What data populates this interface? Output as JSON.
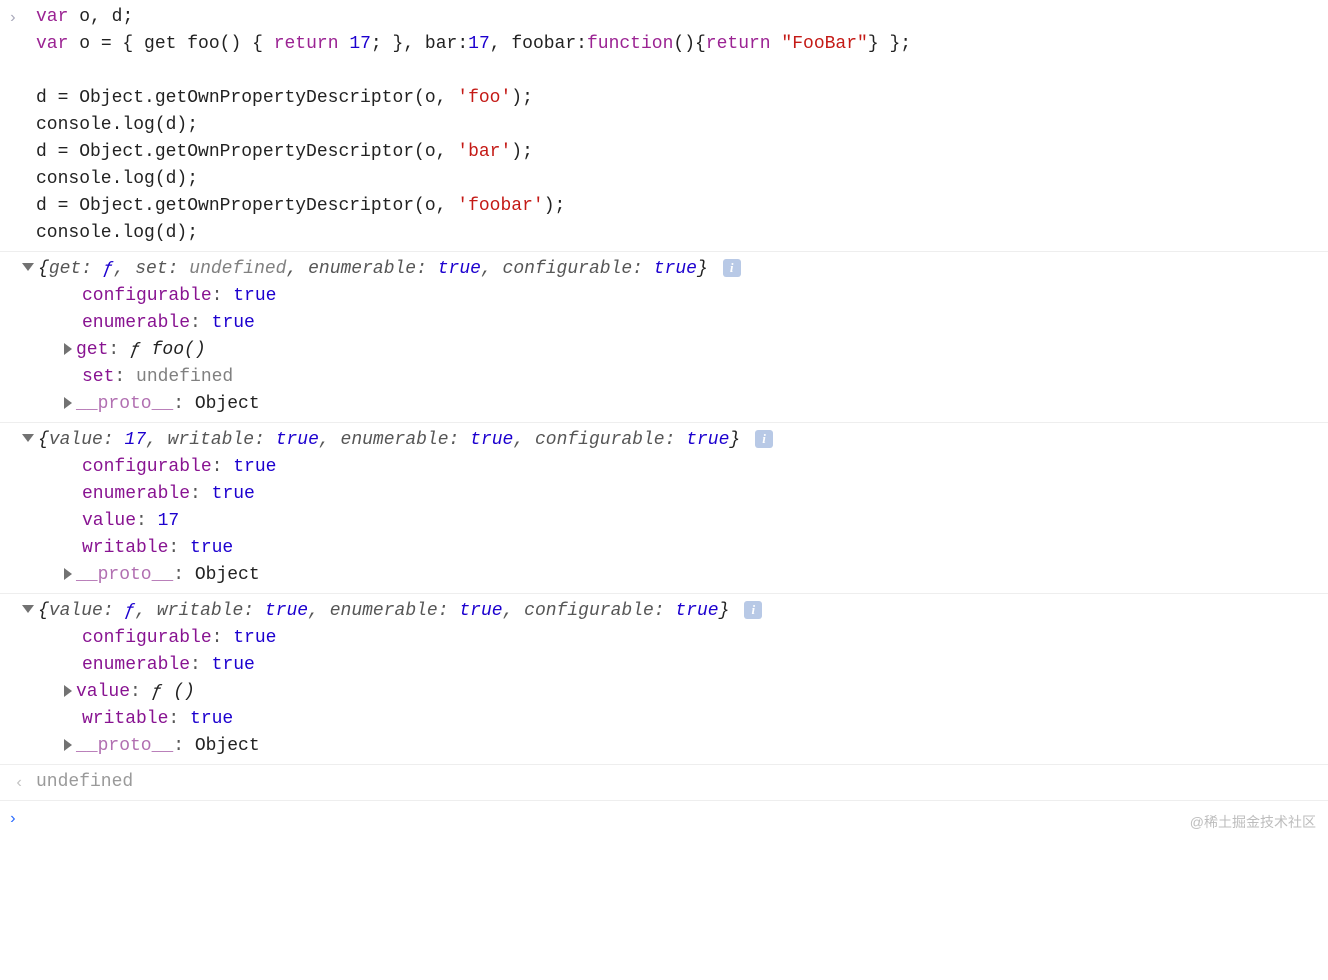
{
  "input": {
    "code_lines": [
      [
        {
          "t": "var ",
          "c": "kw"
        },
        {
          "t": "o"
        },
        {
          "t": ", "
        },
        {
          "t": "d"
        },
        {
          "t": ";"
        }
      ],
      [
        {
          "t": "var ",
          "c": "kw"
        },
        {
          "t": "o"
        },
        {
          "t": " = { "
        },
        {
          "t": "get foo"
        },
        {
          "t": "() { "
        },
        {
          "t": "return ",
          "c": "kw"
        },
        {
          "t": "17",
          "c": "num"
        },
        {
          "t": "; }, bar:"
        },
        {
          "t": "17",
          "c": "num"
        },
        {
          "t": ", foobar:"
        },
        {
          "t": "function",
          "c": "fn"
        },
        {
          "t": "(){"
        },
        {
          "t": "return ",
          "c": "kw"
        },
        {
          "t": "\"FooBar\"",
          "c": "str"
        },
        {
          "t": "} };"
        }
      ],
      [],
      [
        {
          "t": "d = Object.getOwnPropertyDescriptor(o, "
        },
        {
          "t": "'foo'",
          "c": "str"
        },
        {
          "t": ");"
        }
      ],
      [
        {
          "t": "console.log(d);"
        }
      ],
      [
        {
          "t": "d = Object.getOwnPropertyDescriptor(o, "
        },
        {
          "t": "'bar'",
          "c": "str"
        },
        {
          "t": ");"
        }
      ],
      [
        {
          "t": "console.log(d);"
        }
      ],
      [
        {
          "t": "d = Object.getOwnPropertyDescriptor(o, "
        },
        {
          "t": "'foobar'",
          "c": "str"
        },
        {
          "t": ");"
        }
      ],
      [
        {
          "t": "console.log(d);"
        }
      ]
    ]
  },
  "outputs": [
    {
      "summary": [
        {
          "t": "{",
          "c": "summary-brace"
        },
        {
          "t": "get: ",
          "c": "summary-key"
        },
        {
          "t": "ƒ",
          "c": "summary-val"
        },
        {
          "t": ", ",
          "c": "summary-key"
        },
        {
          "t": "set: ",
          "c": "summary-key"
        },
        {
          "t": "undefined",
          "c": "summary-undef"
        },
        {
          "t": ", ",
          "c": "summary-key"
        },
        {
          "t": "enumerable: ",
          "c": "summary-key"
        },
        {
          "t": "true",
          "c": "summary-val"
        },
        {
          "t": ", ",
          "c": "summary-key"
        },
        {
          "t": "configurable: ",
          "c": "summary-key"
        },
        {
          "t": "true",
          "c": "summary-val"
        },
        {
          "t": "}",
          "c": "summary-brace"
        }
      ],
      "props": [
        {
          "expandable": false,
          "key": "configurable",
          "keyClass": "prop-key",
          "val": "true",
          "valClass": "prop-val-bool"
        },
        {
          "expandable": false,
          "key": "enumerable",
          "keyClass": "prop-key",
          "val": "true",
          "valClass": "prop-val-bool"
        },
        {
          "expandable": true,
          "key": "get",
          "keyClass": "prop-key",
          "val": "ƒ foo()",
          "valClass": "prop-val-fn"
        },
        {
          "expandable": false,
          "key": "set",
          "keyClass": "prop-key",
          "val": "undefined",
          "valClass": "prop-val-undef"
        },
        {
          "expandable": true,
          "key": "__proto__",
          "keyClass": "proto",
          "val": "Object",
          "valClass": ""
        }
      ]
    },
    {
      "summary": [
        {
          "t": "{",
          "c": "summary-brace"
        },
        {
          "t": "value: ",
          "c": "summary-key"
        },
        {
          "t": "17",
          "c": "summary-val"
        },
        {
          "t": ", ",
          "c": "summary-key"
        },
        {
          "t": "writable: ",
          "c": "summary-key"
        },
        {
          "t": "true",
          "c": "summary-val"
        },
        {
          "t": ", ",
          "c": "summary-key"
        },
        {
          "t": "enumerable: ",
          "c": "summary-key"
        },
        {
          "t": "true",
          "c": "summary-val"
        },
        {
          "t": ", ",
          "c": "summary-key"
        },
        {
          "t": "configurable: ",
          "c": "summary-key"
        },
        {
          "t": "true",
          "c": "summary-val"
        },
        {
          "t": "}",
          "c": "summary-brace"
        }
      ],
      "props": [
        {
          "expandable": false,
          "key": "configurable",
          "keyClass": "prop-key",
          "val": "true",
          "valClass": "prop-val-bool"
        },
        {
          "expandable": false,
          "key": "enumerable",
          "keyClass": "prop-key",
          "val": "true",
          "valClass": "prop-val-bool"
        },
        {
          "expandable": false,
          "key": "value",
          "keyClass": "prop-key",
          "val": "17",
          "valClass": "prop-val-num"
        },
        {
          "expandable": false,
          "key": "writable",
          "keyClass": "prop-key",
          "val": "true",
          "valClass": "prop-val-bool"
        },
        {
          "expandable": true,
          "key": "__proto__",
          "keyClass": "proto",
          "val": "Object",
          "valClass": ""
        }
      ]
    },
    {
      "summary": [
        {
          "t": "{",
          "c": "summary-brace"
        },
        {
          "t": "value: ",
          "c": "summary-key"
        },
        {
          "t": "ƒ",
          "c": "summary-val"
        },
        {
          "t": ", ",
          "c": "summary-key"
        },
        {
          "t": "writable: ",
          "c": "summary-key"
        },
        {
          "t": "true",
          "c": "summary-val"
        },
        {
          "t": ", ",
          "c": "summary-key"
        },
        {
          "t": "enumerable: ",
          "c": "summary-key"
        },
        {
          "t": "true",
          "c": "summary-val"
        },
        {
          "t": ", ",
          "c": "summary-key"
        },
        {
          "t": "configurable: ",
          "c": "summary-key"
        },
        {
          "t": "true",
          "c": "summary-val"
        },
        {
          "t": "}",
          "c": "summary-brace"
        }
      ],
      "props": [
        {
          "expandable": false,
          "key": "configurable",
          "keyClass": "prop-key",
          "val": "true",
          "valClass": "prop-val-bool"
        },
        {
          "expandable": false,
          "key": "enumerable",
          "keyClass": "prop-key",
          "val": "true",
          "valClass": "prop-val-bool"
        },
        {
          "expandable": true,
          "key": "value",
          "keyClass": "prop-key",
          "val": "ƒ ()",
          "valClass": "prop-val-fn"
        },
        {
          "expandable": false,
          "key": "writable",
          "keyClass": "prop-key",
          "val": "true",
          "valClass": "prop-val-bool"
        },
        {
          "expandable": true,
          "key": "__proto__",
          "keyClass": "proto",
          "val": "Object",
          "valClass": ""
        }
      ]
    }
  ],
  "result": {
    "text": "undefined"
  },
  "info_badge": "i",
  "watermark": "@稀土掘金技术社区"
}
